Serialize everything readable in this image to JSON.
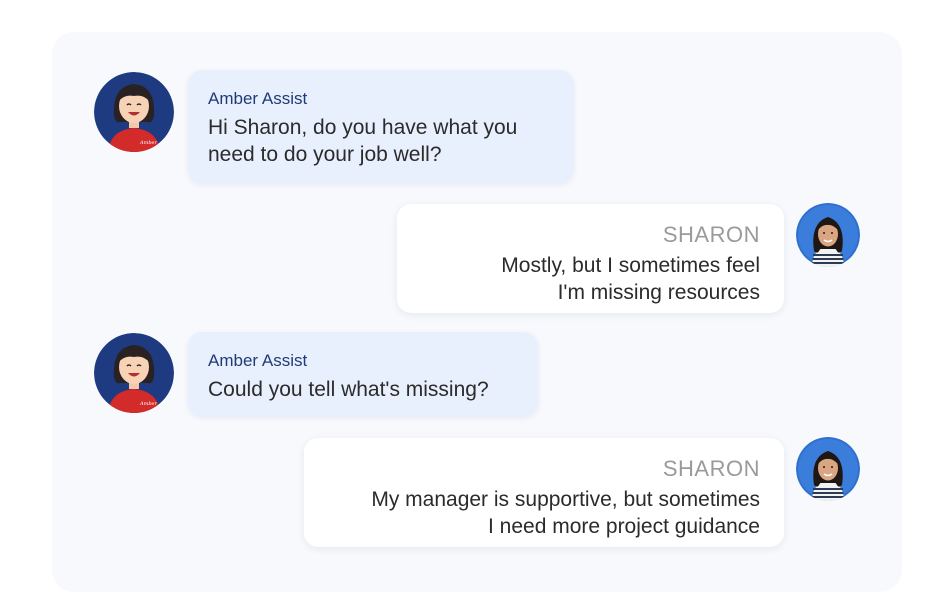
{
  "chat": {
    "messages": [
      {
        "sender": "Amber Assist",
        "role": "bot",
        "avatar_icon": "amber-avatar-icon",
        "text": "Hi Sharon, do you have what you\nneed to do your job well?"
      },
      {
        "sender": "SHARON",
        "role": "user",
        "avatar_icon": "sharon-avatar-icon",
        "text": "Mostly, but I sometimes feel\nI'm missing resources"
      },
      {
        "sender": "Amber Assist",
        "role": "bot",
        "avatar_icon": "amber-avatar-icon",
        "text": "Could you tell what's missing?"
      },
      {
        "sender": "SHARON",
        "role": "user",
        "avatar_icon": "sharon-avatar-icon",
        "text": "My manager is supportive, but sometimes\nI need more project guidance"
      }
    ],
    "amber_shirt_text": "Amber"
  },
  "colors": {
    "panel_bg": "#f7f9fd",
    "bot_bubble": "#e9f0fd",
    "user_bubble": "#ffffff",
    "bot_name": "#1f3b78",
    "user_name": "#9a9a9a",
    "avatar_ring": "#1e3a80",
    "amber_shirt": "#d32a2a"
  }
}
